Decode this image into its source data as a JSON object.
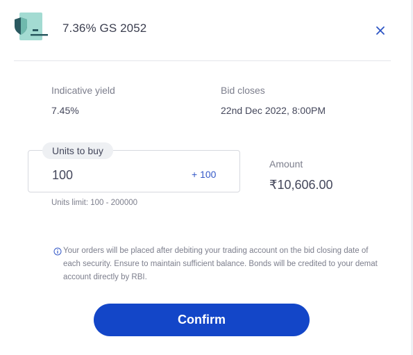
{
  "header": {
    "title": "7.36% GS 2052",
    "logo_icon": "shield-bond-icon",
    "close_icon": "close-icon"
  },
  "details": {
    "yield_label": "Indicative yield",
    "yield_value": "7.45%",
    "bid_label": "Bid closes",
    "bid_value": "22nd Dec 2022, 8:00PM"
  },
  "order": {
    "units_label": "Units to buy",
    "units_value": "100",
    "increment_label": "+ 100",
    "units_limit": "Units limit: 100 - 200000",
    "amount_label": "Amount",
    "amount_value": "₹10,606.00"
  },
  "notice": {
    "icon": "info-icon",
    "text": "Your orders will be placed after debiting your trading account on the bid closing date of each security. Ensure to maintain sufficient balance. Bonds will be credited to your demat account directly by RBI."
  },
  "actions": {
    "confirm_label": "Confirm"
  },
  "colors": {
    "accent": "#1346c8",
    "link": "#3559c7",
    "logo_teal": "#9fd8cf",
    "logo_dark": "#1f4a52"
  }
}
